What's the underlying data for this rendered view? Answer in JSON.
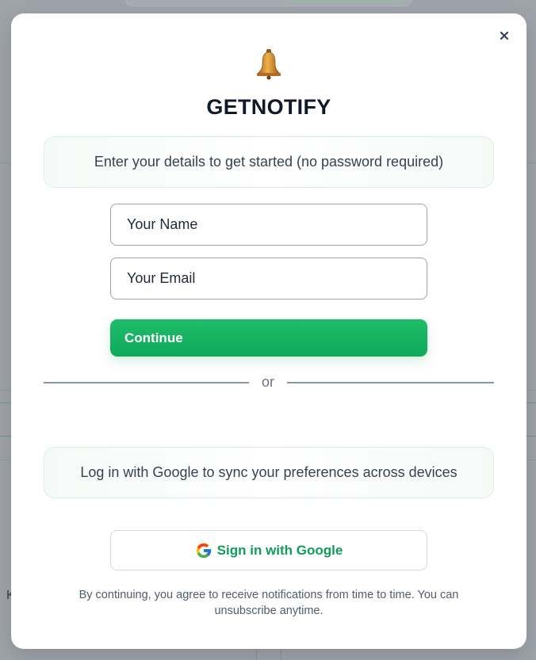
{
  "modal": {
    "title": "GETNOTIFY",
    "intro_text": "Enter your details to get started (no password required)",
    "name_placeholder": "Your Name",
    "email_placeholder": "Your Email",
    "continue_label": "Continue",
    "divider_text": "or",
    "google_info_text": "Log in with Google to sync your preferences across devices",
    "google_button_label": "Sign in with Google",
    "disclaimer": "By continuing, you agree to receive notifications from time to time. You can unsubscribe anytime.",
    "icons": {
      "logo": "bell-icon",
      "close": "close-icon",
      "google": "google-logo-icon"
    }
  },
  "background": {
    "partial_text": "K"
  },
  "colors": {
    "accent": "#10b060",
    "title": "#111827",
    "overlay": "#9fa4ab"
  }
}
